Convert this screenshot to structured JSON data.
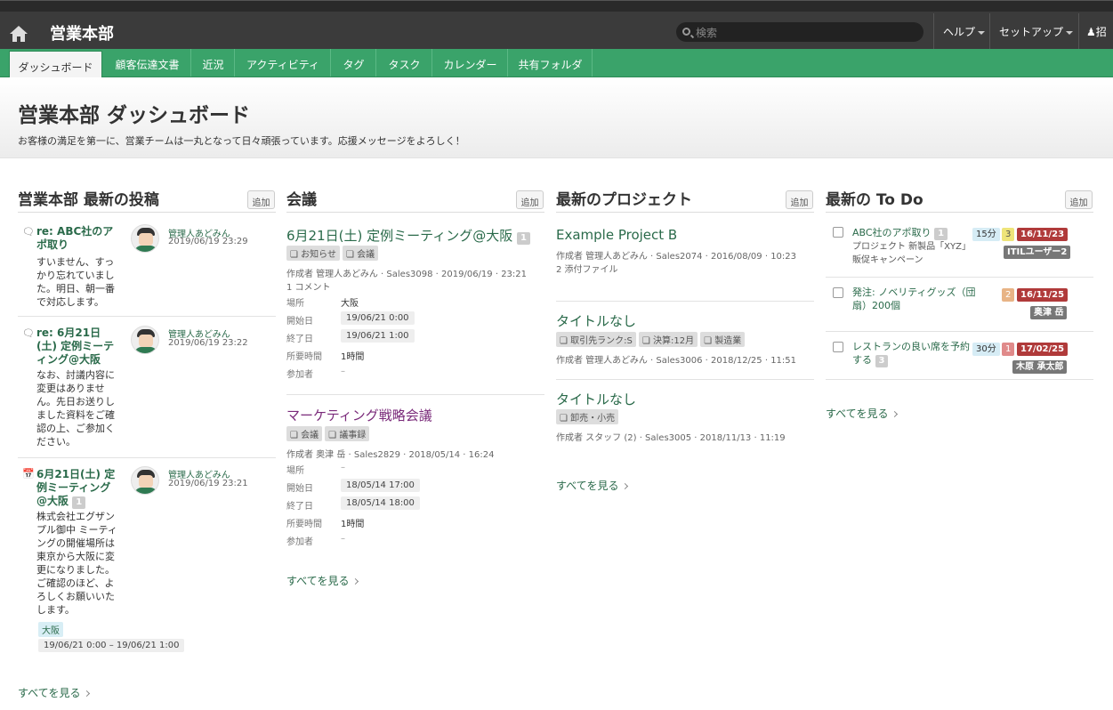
{
  "topbar": {
    "site_title": "営業本部",
    "search_placeholder": "検索",
    "help": "ヘルプ",
    "setup": "セットアップ",
    "invite": "招"
  },
  "tabs": [
    "ダッシュボード",
    "顧客伝達文書",
    "近況",
    "アクティビティ",
    "タグ",
    "タスク",
    "カレンダー",
    "共有フォルダ"
  ],
  "hero": {
    "title": "営業本部 ダッシュボード",
    "subtitle": "お客様の満足を第一に、営業チームは一丸となって日々頑張っています。応援メッセージをよろしく！"
  },
  "columns": {
    "posts": {
      "heading": "営業本部 最新の投稿",
      "add": "追加",
      "see_all": "すべてを見る"
    },
    "meetings": {
      "heading": "会議",
      "add": "追加",
      "see_all": "すべてを見る"
    },
    "projects": {
      "heading": "最新のプロジェクト",
      "add": "追加",
      "see_all": "すべてを見る"
    },
    "todo": {
      "heading": "最新の To Do",
      "add": "追加",
      "see_all": "すべてを見る"
    }
  },
  "posts": [
    {
      "title": "re: ABC社のアポ取り",
      "body": "すいません、すっかり忘れていました。明日、朝一番で対応します。",
      "author": "管理人あどみん",
      "date": "2019/06/19 23:29"
    },
    {
      "title": "re: 6月21日(土) 定例ミーティング@大阪",
      "body": "なお、討議内容に変更はありません。先日お送りしました資料をご確認の上、ご参加ください。",
      "author": "管理人あどみん",
      "date": "2019/06/19 23:22"
    },
    {
      "title": "6月21日(土) 定例ミーティング@大阪",
      "badge": "1",
      "body": "株式会社エグザンプル御中 ミーティングの開催場所は東京から大阪に変更になりました。ご確認のほど、よろしくお願いいたします。",
      "author": "管理人あどみん",
      "date": "2019/06/19 23:21",
      "tag": "大阪",
      "range": "19/06/21 0:00 – 19/06/21 1:00"
    }
  ],
  "meetings": [
    {
      "title": "6月21日(土) 定例ミーティング@大阪",
      "badge": "1",
      "tags": [
        "お知らせ",
        "会議"
      ],
      "meta": "作成者 管理人あどみん · Sales3098 · 2019/06/19 · 23:21",
      "comments": "1 コメント",
      "place_label": "場所",
      "place": "大阪",
      "start_label": "開始日",
      "start": "19/06/21 0:00",
      "end_label": "終了日",
      "end": "19/06/21 1:00",
      "dur_label": "所要時間",
      "dur": "1時間",
      "att_label": "参加者",
      "att": "–"
    },
    {
      "title": "マーケティング戦略会議",
      "tags": [
        "会議",
        "議事録"
      ],
      "meta": "作成者 奥津 岳 · Sales2829 · 2018/05/14 · 16:24",
      "place_label": "場所",
      "place": "–",
      "start_label": "開始日",
      "start": "18/05/14 17:00",
      "end_label": "終了日",
      "end": "18/05/14 18:00",
      "dur_label": "所要時間",
      "dur": "1時間",
      "att_label": "参加者",
      "att": "–"
    }
  ],
  "projects": [
    {
      "title": "Example Project B",
      "meta": "作成者 管理人あどみん · Sales2074 · 2016/08/09 · 10:23",
      "extra": "2 添付ファイル"
    },
    {
      "title": "タイトルなし",
      "tags": [
        "取引先ランク:S",
        "決算:12月",
        "製造業"
      ],
      "meta": "作成者 管理人あどみん · Sales3006 · 2018/12/25 · 11:51"
    },
    {
      "title": "タイトルなし",
      "tags": [
        "卸売・小売"
      ],
      "meta": "作成者 スタッフ (2) · Sales3005 · 2018/11/13 · 11:19"
    }
  ],
  "todos": [
    {
      "title": "ABC社のアポ取り",
      "badge": "1",
      "sub": "プロジェクト 新製品「XYZ」販促キャンペーン",
      "time": "15分",
      "prio": "3",
      "due": "16/11/23",
      "assignee": "ITILユーザー2"
    },
    {
      "title": "発注: ノベリティグッズ（団扇）200個",
      "prio": "2",
      "due": "16/11/25",
      "assignee": "奥津 岳"
    },
    {
      "title": "レストランの良い席を予約する",
      "badge": "3",
      "time": "30分",
      "prio": "1",
      "due": "17/02/25",
      "assignee": "木原 承太郎"
    }
  ],
  "colors": {
    "accent_green": "#3aa36a",
    "topbar": "#3b3b3b",
    "due_red": "#b03a3a"
  }
}
